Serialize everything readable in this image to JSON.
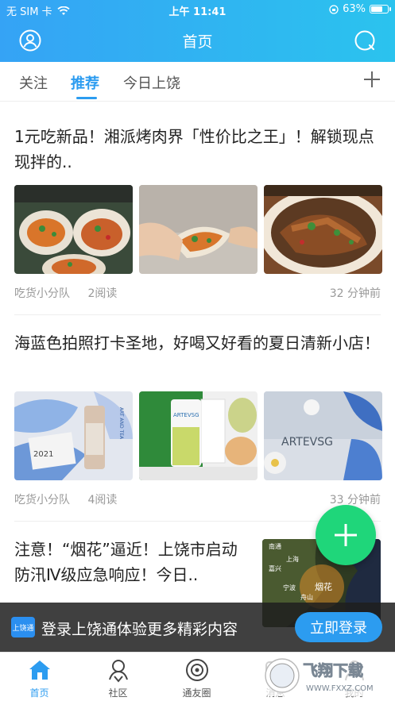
{
  "status_bar": {
    "carrier": "无 SIM 卡",
    "time": "上午 11:41",
    "battery": "63%",
    "battery_level": 0.63
  },
  "header": {
    "title": "首页"
  },
  "tabs": [
    {
      "label": "关注",
      "active": false
    },
    {
      "label": "推荐",
      "active": true
    },
    {
      "label": "今日上饶",
      "active": false
    }
  ],
  "articles": [
    {
      "title": "1元吃新品！湘派烤肉界「性价比之王」！解锁现点现拌的..",
      "author": "吃货小分队",
      "reads": "2阅读",
      "time": "32 分钟前"
    },
    {
      "title": "海蓝色拍照打卡圣地，好喝又好看的夏日清新小店！",
      "author": "吃货小分队",
      "reads": "4阅读",
      "time": "33 分钟前"
    },
    {
      "title": "注意！“烟花”逼近！上饶市启动防汛Ⅳ级应急响应！今日..",
      "map_labels": [
        "南通",
        "上海",
        "嘉兴",
        "宁波",
        "舟山",
        "烟花"
      ]
    }
  ],
  "image_text": {
    "art_and_tea": "ART AND TEA",
    "year": "2021",
    "brand": "ARTEVSG"
  },
  "login_bar": {
    "logo_text": "上饶通",
    "text": "登录上饶通体验更多精彩内容",
    "button": "立即登录"
  },
  "bottom_nav": [
    {
      "label": "首页",
      "icon": "home-icon",
      "active": true
    },
    {
      "label": "社区",
      "icon": "community-icon",
      "active": false
    },
    {
      "label": "通友圈",
      "icon": "circle-icon",
      "active": false
    },
    {
      "label": "消息",
      "icon": "message-icon",
      "active": false
    },
    {
      "label": "我的",
      "icon": "profile-icon",
      "active": false
    }
  ],
  "watermark": {
    "text": "飞翔下载",
    "url": "WWW.FXXZ.COM"
  },
  "colors": {
    "accent": "#2c9cf0",
    "fab": "#1fd67a",
    "header_start": "#35a3f5",
    "header_end": "#2bc3ee"
  }
}
